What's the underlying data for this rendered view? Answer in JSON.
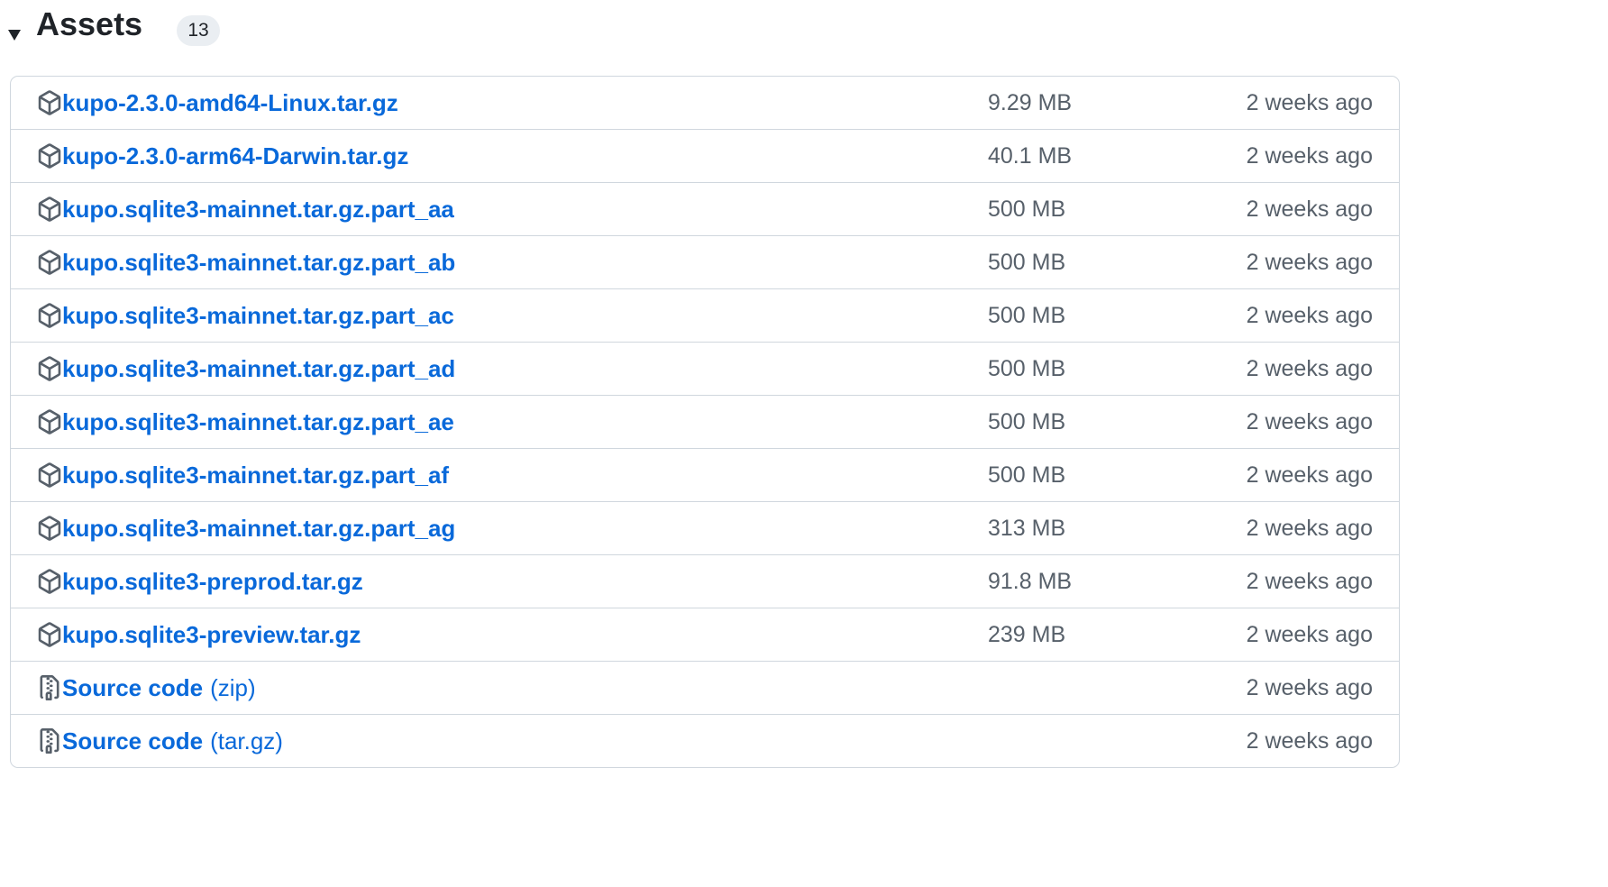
{
  "assets": {
    "title": "Assets",
    "count": "13",
    "items": [
      {
        "name": "kupo-2.3.0-amd64-Linux.tar.gz",
        "ext": "",
        "size": "9.29 MB",
        "time": "2 weeks ago",
        "icon": "package-icon"
      },
      {
        "name": "kupo-2.3.0-arm64-Darwin.tar.gz",
        "ext": "",
        "size": "40.1 MB",
        "time": "2 weeks ago",
        "icon": "package-icon"
      },
      {
        "name": "kupo.sqlite3-mainnet.tar.gz.part_aa",
        "ext": "",
        "size": "500 MB",
        "time": "2 weeks ago",
        "icon": "package-icon"
      },
      {
        "name": "kupo.sqlite3-mainnet.tar.gz.part_ab",
        "ext": "",
        "size": "500 MB",
        "time": "2 weeks ago",
        "icon": "package-icon"
      },
      {
        "name": "kupo.sqlite3-mainnet.tar.gz.part_ac",
        "ext": "",
        "size": "500 MB",
        "time": "2 weeks ago",
        "icon": "package-icon"
      },
      {
        "name": "kupo.sqlite3-mainnet.tar.gz.part_ad",
        "ext": "",
        "size": "500 MB",
        "time": "2 weeks ago",
        "icon": "package-icon"
      },
      {
        "name": "kupo.sqlite3-mainnet.tar.gz.part_ae",
        "ext": "",
        "size": "500 MB",
        "time": "2 weeks ago",
        "icon": "package-icon"
      },
      {
        "name": "kupo.sqlite3-mainnet.tar.gz.part_af",
        "ext": "",
        "size": "500 MB",
        "time": "2 weeks ago",
        "icon": "package-icon"
      },
      {
        "name": "kupo.sqlite3-mainnet.tar.gz.part_ag",
        "ext": "",
        "size": "313 MB",
        "time": "2 weeks ago",
        "icon": "package-icon"
      },
      {
        "name": "kupo.sqlite3-preprod.tar.gz",
        "ext": "",
        "size": "91.8 MB",
        "time": "2 weeks ago",
        "icon": "package-icon"
      },
      {
        "name": "kupo.sqlite3-preview.tar.gz",
        "ext": "",
        "size": "239 MB",
        "time": "2 weeks ago",
        "icon": "package-icon"
      },
      {
        "name": "Source code",
        "ext": "(zip)",
        "size": "",
        "time": "2 weeks ago",
        "icon": "file-zip-icon"
      },
      {
        "name": "Source code",
        "ext": "(tar.gz)",
        "size": "",
        "time": "2 weeks ago",
        "icon": "file-zip-icon"
      }
    ]
  },
  "colors": {
    "link": "#0969da",
    "muted": "#57606a",
    "border": "#d0d7de",
    "badge_bg": "#eaeef2"
  }
}
